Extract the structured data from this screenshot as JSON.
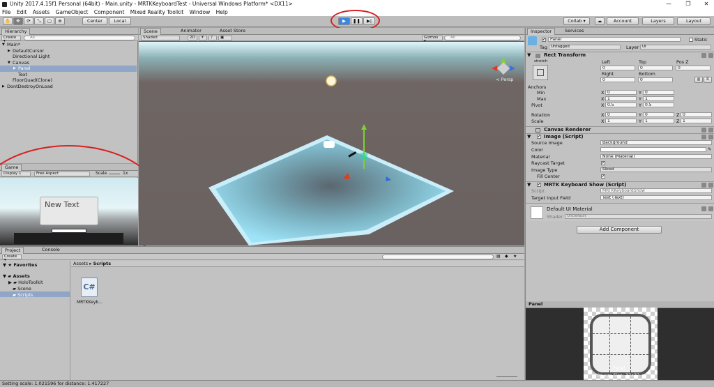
{
  "title": {
    "window_title": "Unity 2017.4.15f1 Personal (64bit) - Main.unity - MRTKKeyboardTest - Universal Windows Platform* <DX11>",
    "min": "—",
    "max": "❐",
    "close": "✕"
  },
  "menu": [
    "File",
    "Edit",
    "Assets",
    "GameObject",
    "Component",
    "Mixed Reality Toolkit",
    "Window",
    "Help"
  ],
  "toolbar": {
    "center": "Center",
    "local": "Local",
    "collab": "Collab ▾",
    "account": "Account",
    "layers": "Layers",
    "layout": "Layout"
  },
  "hierarchy": {
    "tab": "Hierarchy",
    "create": "Create ▾",
    "search": "All",
    "items": [
      {
        "label": "Main*",
        "indent": 0,
        "arrow": "▼"
      },
      {
        "label": "DefaultCursor",
        "indent": 1,
        "arrow": "▶"
      },
      {
        "label": "Directional Light",
        "indent": 1,
        "arrow": ""
      },
      {
        "label": "Canvas",
        "indent": 1,
        "arrow": "▼"
      },
      {
        "label": "Panel",
        "indent": 2,
        "arrow": "▶",
        "selected": true
      },
      {
        "label": "Text",
        "indent": 2,
        "arrow": ""
      },
      {
        "label": "FloorQuad(Clone)",
        "indent": 1,
        "arrow": ""
      },
      {
        "label": "DontDestroyOnLoad",
        "indent": 0,
        "arrow": "▶"
      }
    ]
  },
  "scene": {
    "tabs": [
      "Scene",
      "Animator",
      "Asset Store"
    ],
    "shaded": "Shaded",
    "mode2d": "2D",
    "gizmos": "Gizmos ▾",
    "search": "All",
    "persp": "< Persp"
  },
  "game": {
    "tab": "Game",
    "display": "Display 1",
    "aspect": "Free Aspect",
    "scale_label": "Scale",
    "scale_val": "1x",
    "button_text": "New Text"
  },
  "project": {
    "tabs": [
      "Project",
      "Console"
    ],
    "create": "Create ▾",
    "favorites": "Favorites",
    "assets": "Assets",
    "tree": [
      "HoloToolkit",
      "Scene",
      "Scripts"
    ],
    "breadcrumb": [
      "Assets",
      "Scripts"
    ],
    "file_label": "MRTKKeyb...",
    "file_icon": "C#"
  },
  "inspector": {
    "tabs": [
      "Inspector",
      "Services"
    ],
    "name": "Panel",
    "static": "Static",
    "tag_label": "Tag",
    "tag": "Untagged",
    "layer_label": "Layer",
    "layer": "UI",
    "rect": {
      "title": "Rect Transform",
      "stretch": "stretch",
      "left": "Left",
      "top": "Top",
      "posz": "Pos Z",
      "lv": "0",
      "tv": "0",
      "zv": "0",
      "right": "Right",
      "bottom": "Bottom",
      "rv": "0",
      "bv": "0",
      "r_btn": "R",
      "anchors": "Anchors",
      "min": "Min",
      "max": "Max",
      "pivot": "Pivot",
      "min_x": "0",
      "min_y": "0",
      "max_x": "1",
      "max_y": "1",
      "piv_x": "0.5",
      "piv_y": "0.5",
      "rotation": "Rotation",
      "scale": "Scale",
      "rot_x": "0",
      "rot_y": "0",
      "rot_z": "0",
      "sc_x": "1",
      "sc_y": "1",
      "sc_z": "1",
      "x": "X",
      "y": "Y",
      "z": "Z"
    },
    "canvas_renderer": "Canvas Renderer",
    "image": {
      "title": "Image (Script)",
      "source_label": "Source Image",
      "source": "Background",
      "color_label": "Color",
      "material_label": "Material",
      "material": "None (Material)",
      "raycast": "Raycast Target",
      "type_label": "Image Type",
      "type": "Sliced",
      "fill": "Fill Center"
    },
    "mrtk": {
      "title": "MRTK Keyboard Show (Script)",
      "script_label": "Script",
      "script": "MRTKKeyboardShow",
      "target_label": "Target Input Field",
      "target": "Text (Text)"
    },
    "material": {
      "title": "Default UI Material",
      "shader_label": "Shader",
      "shader": "UI/Default"
    },
    "add_component": "Add Component"
  },
  "preview": {
    "title": "Panel",
    "caption": "Panel",
    "size": "Image Size: 32x32"
  },
  "status": "Setting scale: 1.021596 for distance: 1.417227",
  "colors": {
    "accent": "#3d86e0",
    "annotation": "#d92020",
    "sky": "#d2ecf2",
    "floor": "#8fd7ee"
  }
}
